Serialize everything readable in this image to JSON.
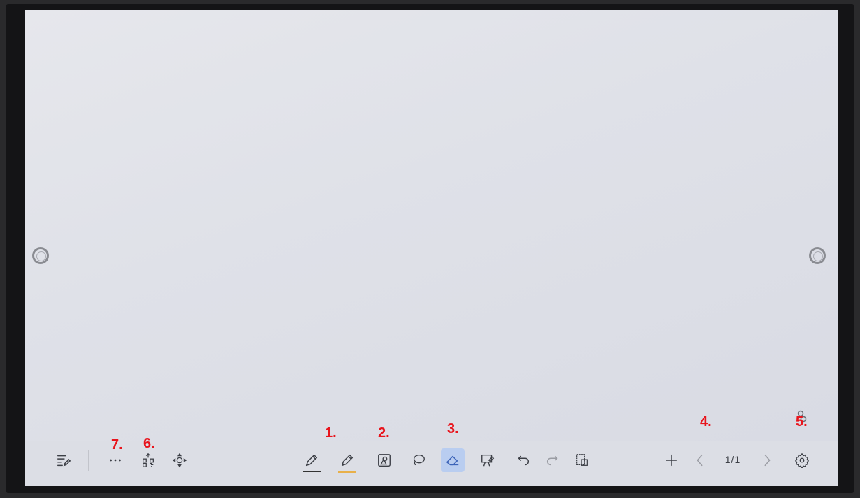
{
  "toolbar": {
    "buttons": [
      {
        "name": "exit-whiteboard",
        "icon": "list-edit-icon"
      },
      {
        "name": "more",
        "icon": "ellipsis-icon"
      },
      {
        "name": "share-qr",
        "icon": "qr-share-icon"
      },
      {
        "name": "move-canvas",
        "icon": "move-arrows-icon"
      },
      {
        "name": "pen",
        "icon": "pen-icon"
      },
      {
        "name": "highlighter",
        "icon": "highlighter-icon"
      },
      {
        "name": "shapes",
        "icon": "shapes-icon"
      },
      {
        "name": "lasso-select",
        "icon": "lasso-icon"
      },
      {
        "name": "eraser",
        "icon": "eraser-icon",
        "active": true
      },
      {
        "name": "insert-image",
        "icon": "board-icon"
      },
      {
        "name": "undo",
        "icon": "undo-icon"
      },
      {
        "name": "redo",
        "icon": "redo-icon",
        "disabled": true
      },
      {
        "name": "clipboard",
        "icon": "clipboard-icon"
      },
      {
        "name": "add-page",
        "icon": "plus-icon"
      },
      {
        "name": "prev-page",
        "icon": "chevron-left-icon",
        "disabled": true
      },
      {
        "name": "next-page",
        "icon": "chevron-right-icon",
        "disabled": true
      },
      {
        "name": "settings",
        "icon": "gear-icon"
      }
    ],
    "page_indicator": "1/1"
  },
  "annotations": {
    "a1": "1.",
    "a2": "2.",
    "a3": "3.",
    "a4": "4.",
    "a5": "5.",
    "a6": "6.",
    "a7": "7."
  },
  "colors": {
    "annotation": "#e8141c",
    "eraser_active_bg": "#b9cdf0",
    "highlighter_underline": "#e8b04a"
  }
}
